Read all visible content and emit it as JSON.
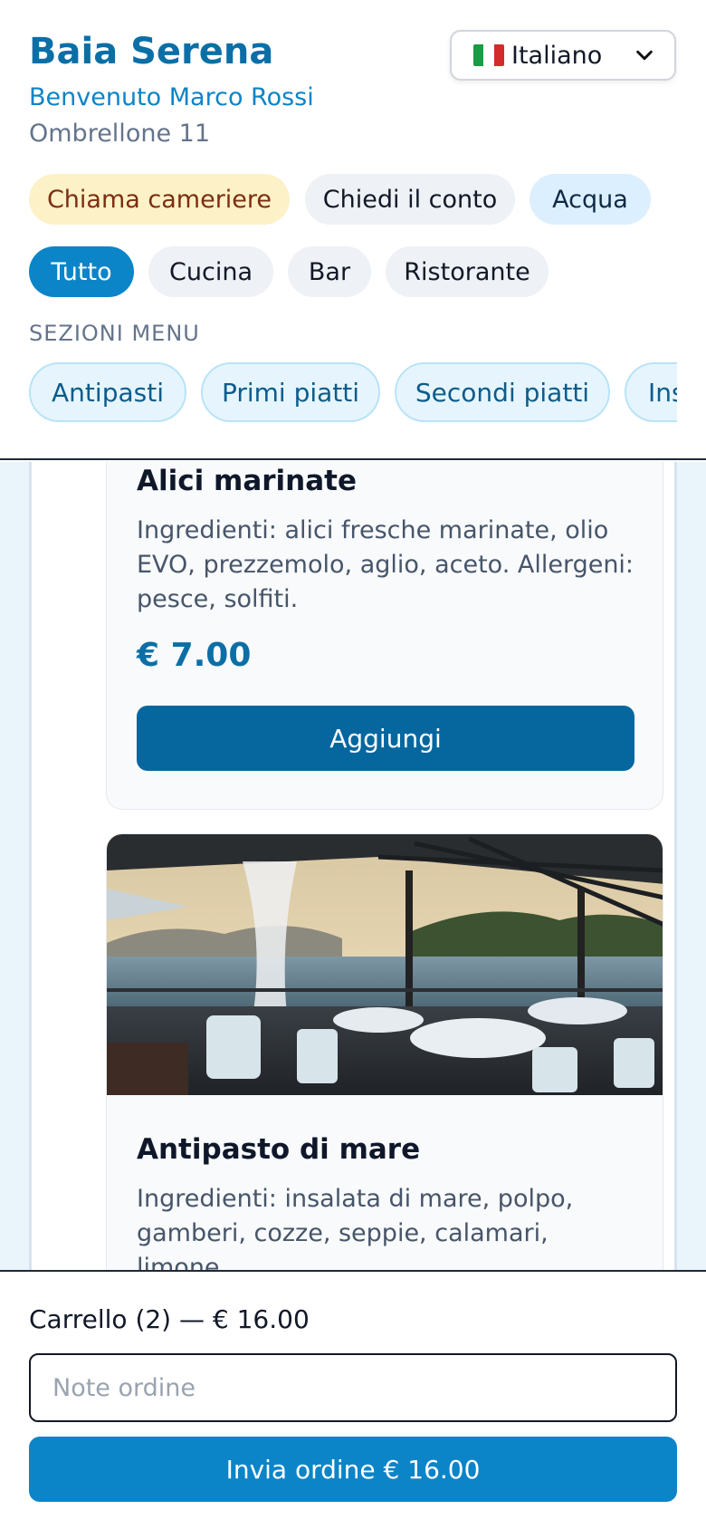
{
  "header": {
    "brand": "Baia Serena",
    "welcome": "Benvenuto Marco Rossi",
    "umbrella": "Ombrellone 11",
    "language": {
      "selected": "Italiano",
      "flag": "italy-flag-icon"
    }
  },
  "quick_actions": [
    {
      "label": "Chiama cameriere"
    },
    {
      "label": "Chiedi il conto"
    },
    {
      "label": "Acqua"
    }
  ],
  "filters": [
    {
      "label": "Tutto",
      "active": true
    },
    {
      "label": "Cucina",
      "active": false
    },
    {
      "label": "Bar",
      "active": false
    },
    {
      "label": "Ristorante",
      "active": false
    }
  ],
  "sections": {
    "title": "SEZIONI MENU",
    "items": [
      "Antipasti",
      "Primi piatti",
      "Secondi piatti",
      "Insalate"
    ]
  },
  "menu_items": [
    {
      "name": "Alici marinate",
      "description": "Ingredienti: alici fresche marinate, olio EVO, prezzemolo, aglio, aceto. Allergeni: pesce, solfiti.",
      "price": "€ 7.00",
      "add_label": "Aggiungi"
    },
    {
      "name": "Antipasto di mare",
      "description": "Ingredienti: insalata di mare, polpo, gamberi, cozze, seppie, calamari, limone,",
      "image": "lakeside-terrace-restaurant-photo"
    }
  ],
  "cart": {
    "summary": "Carrello (2) — € 16.00",
    "notes_placeholder": "Note ordine",
    "notes_value": "",
    "send_label": "Invia ordine € 16.00"
  },
  "colors": {
    "brand": "#0b6fa6",
    "accent": "#0b84c8",
    "call_waiter_bg": "#fdf1c7",
    "content_bg": "#eaf4fb"
  }
}
